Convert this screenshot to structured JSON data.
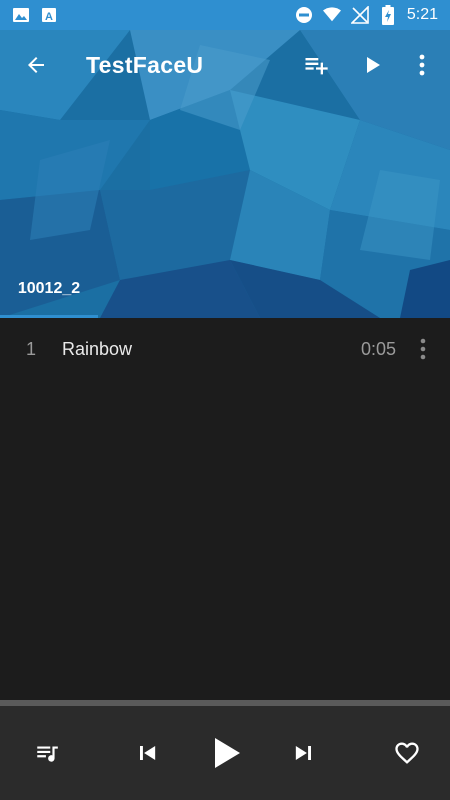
{
  "status_bar": {
    "time": "5:21",
    "icons": [
      "image-icon",
      "text-a-icon",
      "do-not-disturb-icon",
      "wifi-icon",
      "no-signal-icon",
      "battery-charging-icon"
    ]
  },
  "toolbar": {
    "title": "TestFaceU",
    "back_icon": "arrow-back-icon",
    "actions": [
      "playlist-add-icon",
      "play-icon",
      "more-vert-icon"
    ]
  },
  "tabs": [
    {
      "label": "10012_2",
      "selected": true
    }
  ],
  "tracks": [
    {
      "number": "1",
      "title": "Rainbow",
      "duration": "0:05"
    }
  ],
  "player": {
    "controls": [
      "queue-music-icon",
      "skip-previous-icon",
      "play-icon",
      "skip-next-icon",
      "favorite-border-icon"
    ],
    "progress": 0
  },
  "colors": {
    "accent": "#2f8fd0",
    "background": "#1c1c1c",
    "player_bg": "#2b2b2b"
  }
}
